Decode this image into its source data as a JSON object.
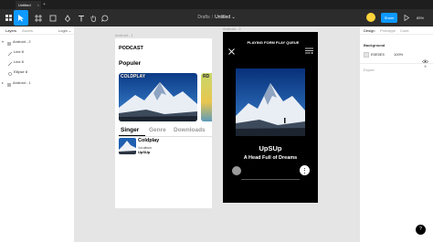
{
  "tabbar": {
    "tab_label": "Untitled",
    "close_glyph": "×",
    "new_tab_glyph": "+"
  },
  "toolbar": {
    "breadcrumb_parent": "Drafts",
    "breadcrumb_separator": "/",
    "file_name": "Untitled",
    "file_menu_glyph": "⌄",
    "share_label": "Share",
    "zoom_label": "85%",
    "accent_color": "#0d99ff",
    "icons": [
      "main-menu-icon",
      "move-tool-icon",
      "frame-tool-icon",
      "shape-tool-icon",
      "pen-tool-icon",
      "text-tool-icon",
      "hand-tool-icon",
      "comment-tool-icon",
      "play-icon"
    ]
  },
  "layers_panel": {
    "tabs": {
      "layers": "Layers",
      "assets": "Assets",
      "page": "Login"
    },
    "page_menu_glyph": "⌄",
    "items": [
      {
        "label": "Android - 2",
        "icon": "frame-icon"
      },
      {
        "label": "Line 8",
        "icon": "line-icon"
      },
      {
        "label": "Line 8",
        "icon": "line-icon"
      },
      {
        "label": "Ellipse 8",
        "icon": "ellipse-icon"
      },
      {
        "label": "Android - 1",
        "icon": "frame-icon"
      }
    ]
  },
  "canvas": {
    "frame1_label": "Android - 1",
    "frame2_label": "Android - 2",
    "frame1": {
      "app_title": "PODCAST",
      "section_title": "Populer",
      "card1_title": "COLDPLAY",
      "card2_title": "RD",
      "categories": [
        {
          "label": "Singer",
          "active": true
        },
        {
          "label": "Genre",
          "active": false
        },
        {
          "label": "Downloads",
          "active": false
        }
      ],
      "track": {
        "artist": "Coldplay",
        "album": "1st album",
        "title": "UpSUp"
      }
    },
    "frame2": {
      "queue_title": "PLAYING FORM PLAY QUEUE",
      "song_title": "UpSUp",
      "artist_line": "A Head Full of Dreams"
    }
  },
  "properties_panel": {
    "tabs": [
      "Design",
      "Prototype",
      "Code"
    ],
    "background_title": "Background",
    "background_hex": "E5E5E5",
    "background_opacity": "100%",
    "export_label": "Export",
    "add_glyph": "+"
  },
  "help_label": "?"
}
